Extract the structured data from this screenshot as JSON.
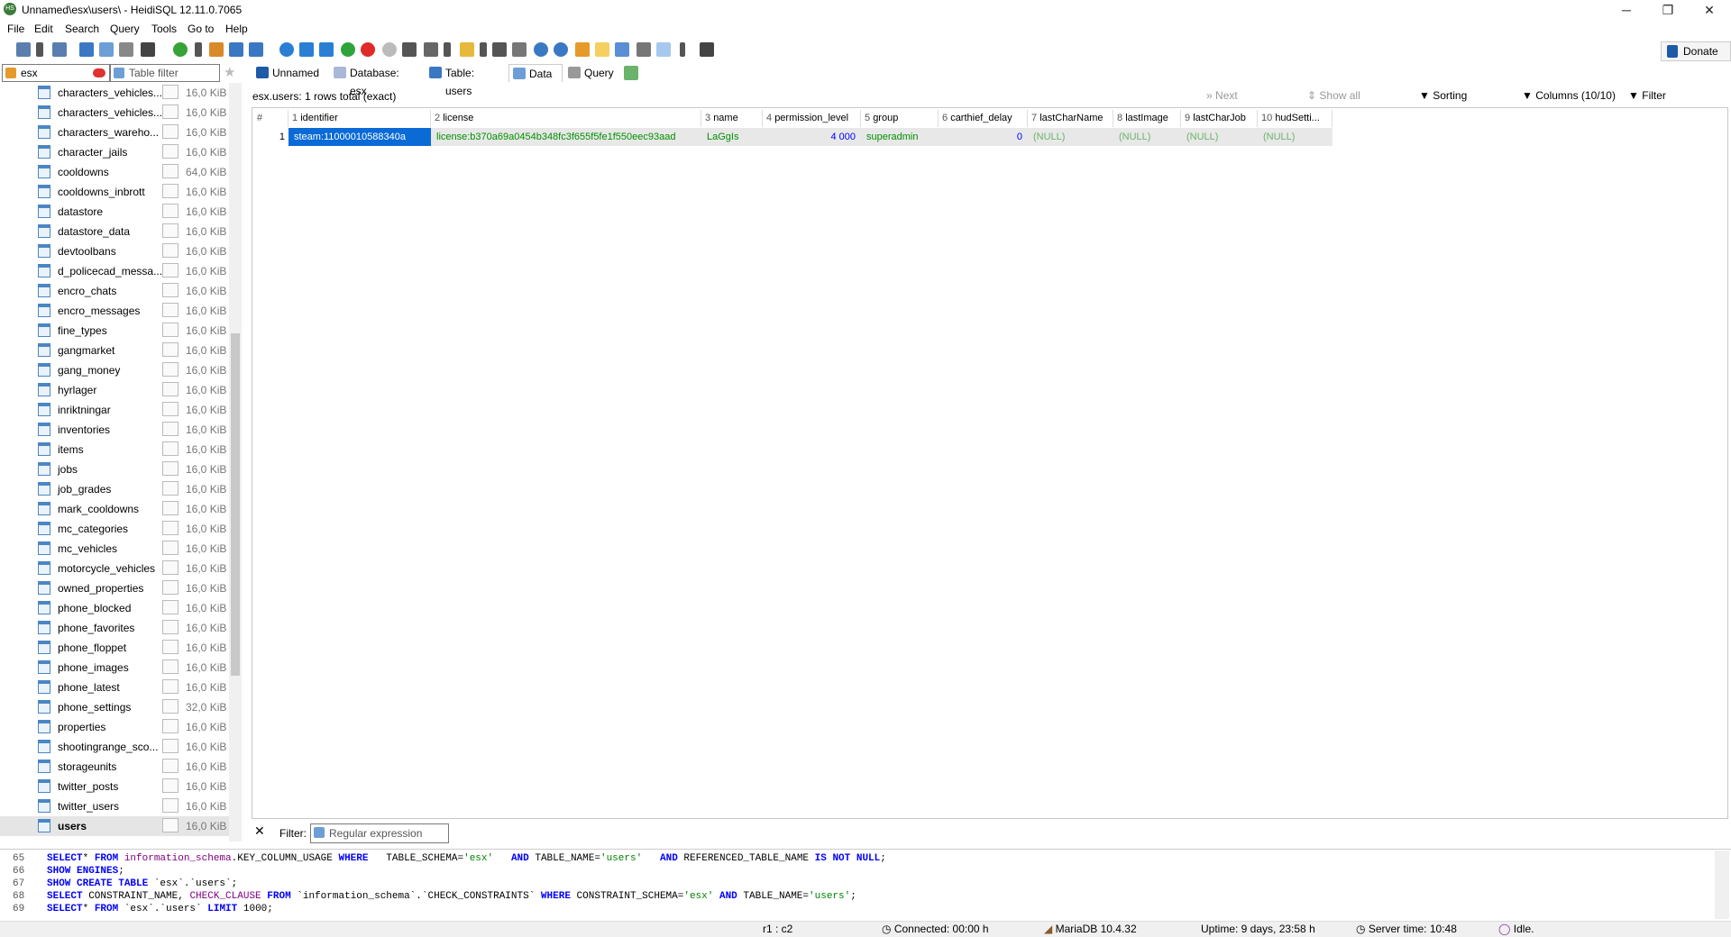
{
  "window": {
    "title": "Unnamed\\esx\\users\\ - HeidiSQL 12.11.0.7065",
    "app_icon_text": "HS",
    "minimize": "─",
    "restore": "❐",
    "close": "✕"
  },
  "menu": [
    "File",
    "Edit",
    "Search",
    "Query",
    "Tools",
    "Go to",
    "Help"
  ],
  "toolbar": {
    "donate_label": "Donate"
  },
  "filters": {
    "database_filter_value": "esx",
    "table_filter_placeholder": "Table filter"
  },
  "tabs": [
    {
      "label": "Unnamed"
    },
    {
      "label": "Database: esx"
    },
    {
      "label": "Table: users"
    },
    {
      "label": "Data"
    },
    {
      "label": "Query"
    }
  ],
  "tree": {
    "items": [
      {
        "name": "characters_vehicles...",
        "size": "16,0 KiB"
      },
      {
        "name": "characters_vehicles...",
        "size": "16,0 KiB"
      },
      {
        "name": "characters_wareho...",
        "size": "16,0 KiB"
      },
      {
        "name": "character_jails",
        "size": "16,0 KiB"
      },
      {
        "name": "cooldowns",
        "size": "64,0 KiB"
      },
      {
        "name": "cooldowns_inbrott",
        "size": "16,0 KiB"
      },
      {
        "name": "datastore",
        "size": "16,0 KiB"
      },
      {
        "name": "datastore_data",
        "size": "16,0 KiB"
      },
      {
        "name": "devtoolbans",
        "size": "16,0 KiB"
      },
      {
        "name": "d_policecad_messa...",
        "size": "16,0 KiB"
      },
      {
        "name": "encro_chats",
        "size": "16,0 KiB"
      },
      {
        "name": "encro_messages",
        "size": "16,0 KiB"
      },
      {
        "name": "fine_types",
        "size": "16,0 KiB"
      },
      {
        "name": "gangmarket",
        "size": "16,0 KiB"
      },
      {
        "name": "gang_money",
        "size": "16,0 KiB"
      },
      {
        "name": "hyrlager",
        "size": "16,0 KiB"
      },
      {
        "name": "inriktningar",
        "size": "16,0 KiB"
      },
      {
        "name": "inventories",
        "size": "16,0 KiB"
      },
      {
        "name": "items",
        "size": "16,0 KiB"
      },
      {
        "name": "jobs",
        "size": "16,0 KiB"
      },
      {
        "name": "job_grades",
        "size": "16,0 KiB"
      },
      {
        "name": "mark_cooldowns",
        "size": "16,0 KiB"
      },
      {
        "name": "mc_categories",
        "size": "16,0 KiB"
      },
      {
        "name": "mc_vehicles",
        "size": "16,0 KiB"
      },
      {
        "name": "motorcycle_vehicles",
        "size": "16,0 KiB"
      },
      {
        "name": "owned_properties",
        "size": "16,0 KiB"
      },
      {
        "name": "phone_blocked",
        "size": "16,0 KiB"
      },
      {
        "name": "phone_favorites",
        "size": "16,0 KiB"
      },
      {
        "name": "phone_floppet",
        "size": "16,0 KiB"
      },
      {
        "name": "phone_images",
        "size": "16,0 KiB"
      },
      {
        "name": "phone_latest",
        "size": "16,0 KiB"
      },
      {
        "name": "phone_settings",
        "size": "32,0 KiB"
      },
      {
        "name": "properties",
        "size": "16,0 KiB"
      },
      {
        "name": "shootingrange_sco...",
        "size": "16,0 KiB"
      },
      {
        "name": "storageunits",
        "size": "16,0 KiB"
      },
      {
        "name": "twitter_posts",
        "size": "16,0 KiB"
      },
      {
        "name": "twitter_users",
        "size": "16,0 KiB"
      },
      {
        "name": "users",
        "size": "16,0 KiB"
      }
    ]
  },
  "grid": {
    "status": "esx.users: 1 rows total (exact)",
    "next_label": "Next",
    "show_all_label": "Show all",
    "sorting_label": "Sorting",
    "columns_label": "Columns (10/10)",
    "filter_label": "Filter",
    "columns": [
      {
        "num": "#",
        "name": ""
      },
      {
        "num": "1",
        "name": "identifier"
      },
      {
        "num": "2",
        "name": "license"
      },
      {
        "num": "3",
        "name": "name"
      },
      {
        "num": "4",
        "name": "permission_level"
      },
      {
        "num": "5",
        "name": "group"
      },
      {
        "num": "6",
        "name": "carthief_delay"
      },
      {
        "num": "7",
        "name": "lastCharName"
      },
      {
        "num": "8",
        "name": "lastImage"
      },
      {
        "num": "9",
        "name": "lastCharJob"
      },
      {
        "num": "10",
        "name": "hudSetti..."
      }
    ],
    "row": {
      "num": "1",
      "identifier": "steam:11000010588340a",
      "license": "license:b370a69a0454b348fc3f655f5fe1f550eec93aad",
      "name": "LaGgIs",
      "permission_level": "4 000",
      "group": "superadmin",
      "carthief_delay": "0",
      "lastCharName": "(NULL)",
      "lastImage": "(NULL)",
      "lastCharJob": "(NULL)",
      "hudSettings": "(NULL)"
    },
    "filter_close": "✕",
    "filter_prefix": "Filter:",
    "filter_placeholder": "Regular expression"
  },
  "sql_log": [
    {
      "num": "65",
      "parts": [
        [
          "kw",
          "SELECT"
        ],
        [
          "",
          "* "
        ],
        [
          "kw",
          "FROM"
        ],
        [
          "id",
          " information_schema"
        ],
        [
          "",
          ".KEY_COLUMN_USAGE "
        ],
        [
          "kw",
          "WHERE"
        ],
        [
          "",
          "   TABLE_SCHEMA="
        ],
        [
          "str",
          "'esx'"
        ],
        [
          "",
          "   "
        ],
        [
          "kw",
          "AND"
        ],
        [
          "",
          " TABLE_NAME="
        ],
        [
          "str",
          "'users'"
        ],
        [
          "",
          "   "
        ],
        [
          "kw",
          "AND"
        ],
        [
          "",
          " REFERENCED_TABLE_NAME "
        ],
        [
          "kw",
          "IS NOT NULL"
        ],
        [
          "",
          ";"
        ]
      ]
    },
    {
      "num": "66",
      "parts": [
        [
          "kw",
          "SHOW ENGINES"
        ],
        [
          "",
          ";"
        ]
      ]
    },
    {
      "num": "67",
      "parts": [
        [
          "kw",
          "SHOW CREATE TABLE"
        ],
        [
          "",
          " `esx`.`users`;"
        ]
      ]
    },
    {
      "num": "68",
      "parts": [
        [
          "kw",
          "SELECT"
        ],
        [
          "",
          " CONSTRAINT_NAME, "
        ],
        [
          "id",
          "CHECK_CLAUSE"
        ],
        [
          "",
          " "
        ],
        [
          "kw",
          "FROM"
        ],
        [
          "",
          " `information_schema`.`CHECK_CONSTRAINTS` "
        ],
        [
          "kw",
          "WHERE"
        ],
        [
          "",
          " CONSTRAINT_SCHEMA="
        ],
        [
          "str",
          "'esx'"
        ],
        [
          "",
          " "
        ],
        [
          "kw",
          "AND"
        ],
        [
          "",
          " TABLE_NAME="
        ],
        [
          "str",
          "'users'"
        ],
        [
          "",
          ";"
        ]
      ]
    },
    {
      "num": "69",
      "parts": [
        [
          "kw",
          "SELECT"
        ],
        [
          "",
          "* "
        ],
        [
          "kw",
          "FROM"
        ],
        [
          "",
          " `esx`.`users` "
        ],
        [
          "kw",
          "LIMIT"
        ],
        [
          "",
          " 1000;"
        ]
      ]
    }
  ],
  "statusbar": {
    "cursor": "r1 : c2",
    "connected": "Connected: 00:00 h",
    "server": "MariaDB 10.4.32",
    "uptime": "Uptime: 9 days, 23:58 h",
    "server_time": "Server time: 10:48",
    "state": "Idle."
  }
}
